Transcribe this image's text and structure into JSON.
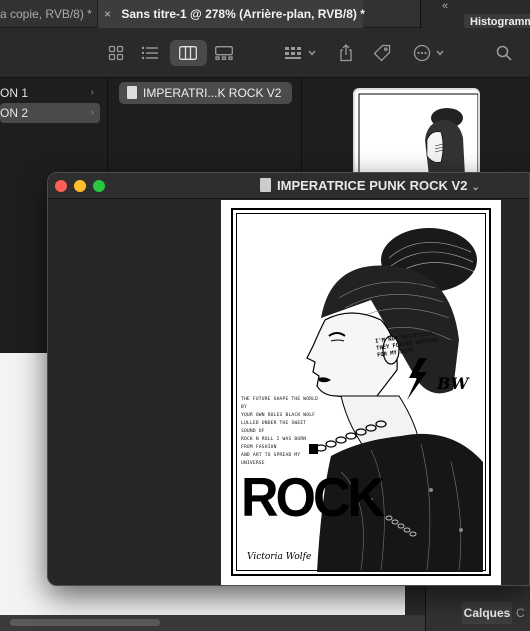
{
  "ps_tabs": {
    "tab1": "a copie, RVB/8) *",
    "tab2_close": "×",
    "tab2": "Sans titre-1 @ 278% (Arrière-plan, RVB/8) *",
    "collapse": "«",
    "histogram": "Histogramme"
  },
  "finder": {
    "col1": [
      {
        "label": "ON 1",
        "selected": false
      },
      {
        "label": "ON 2",
        "selected": true
      }
    ],
    "file_name": "IMPERATRI...K ROCK V2",
    "toolbar_icons": [
      "grid-view-icon",
      "list-view-icon",
      "column-view-icon",
      "gallery-view-icon",
      "group-icon",
      "share-icon",
      "tag-icon",
      "more-icon",
      "search-icon"
    ]
  },
  "preview": {
    "title": "IMPERATRICE PUNK ROCK V2",
    "caret": "⌄"
  },
  "poster": {
    "blurb_lines": [
      "THE FUTURE SHAPE THE WORLD BY",
      "YOUR OWN RULES BLACK WOLF",
      "LULLED UNDER THE SWEET SOUND OF",
      "ROCK N ROLL I WAS BORN FROM FASHION",
      "AND ART TO SPREAD MY UNIVERSE"
    ],
    "headline": "ROCK",
    "signature": "Victoria Wolfe",
    "monogram": "BW",
    "cheek_text": "I'M NOT ARTIFICIAL, THEY FORCED NOTHING FOR MY BODY"
  },
  "right_panel": {
    "tab_layers": "Calques",
    "tab_next": "C"
  }
}
